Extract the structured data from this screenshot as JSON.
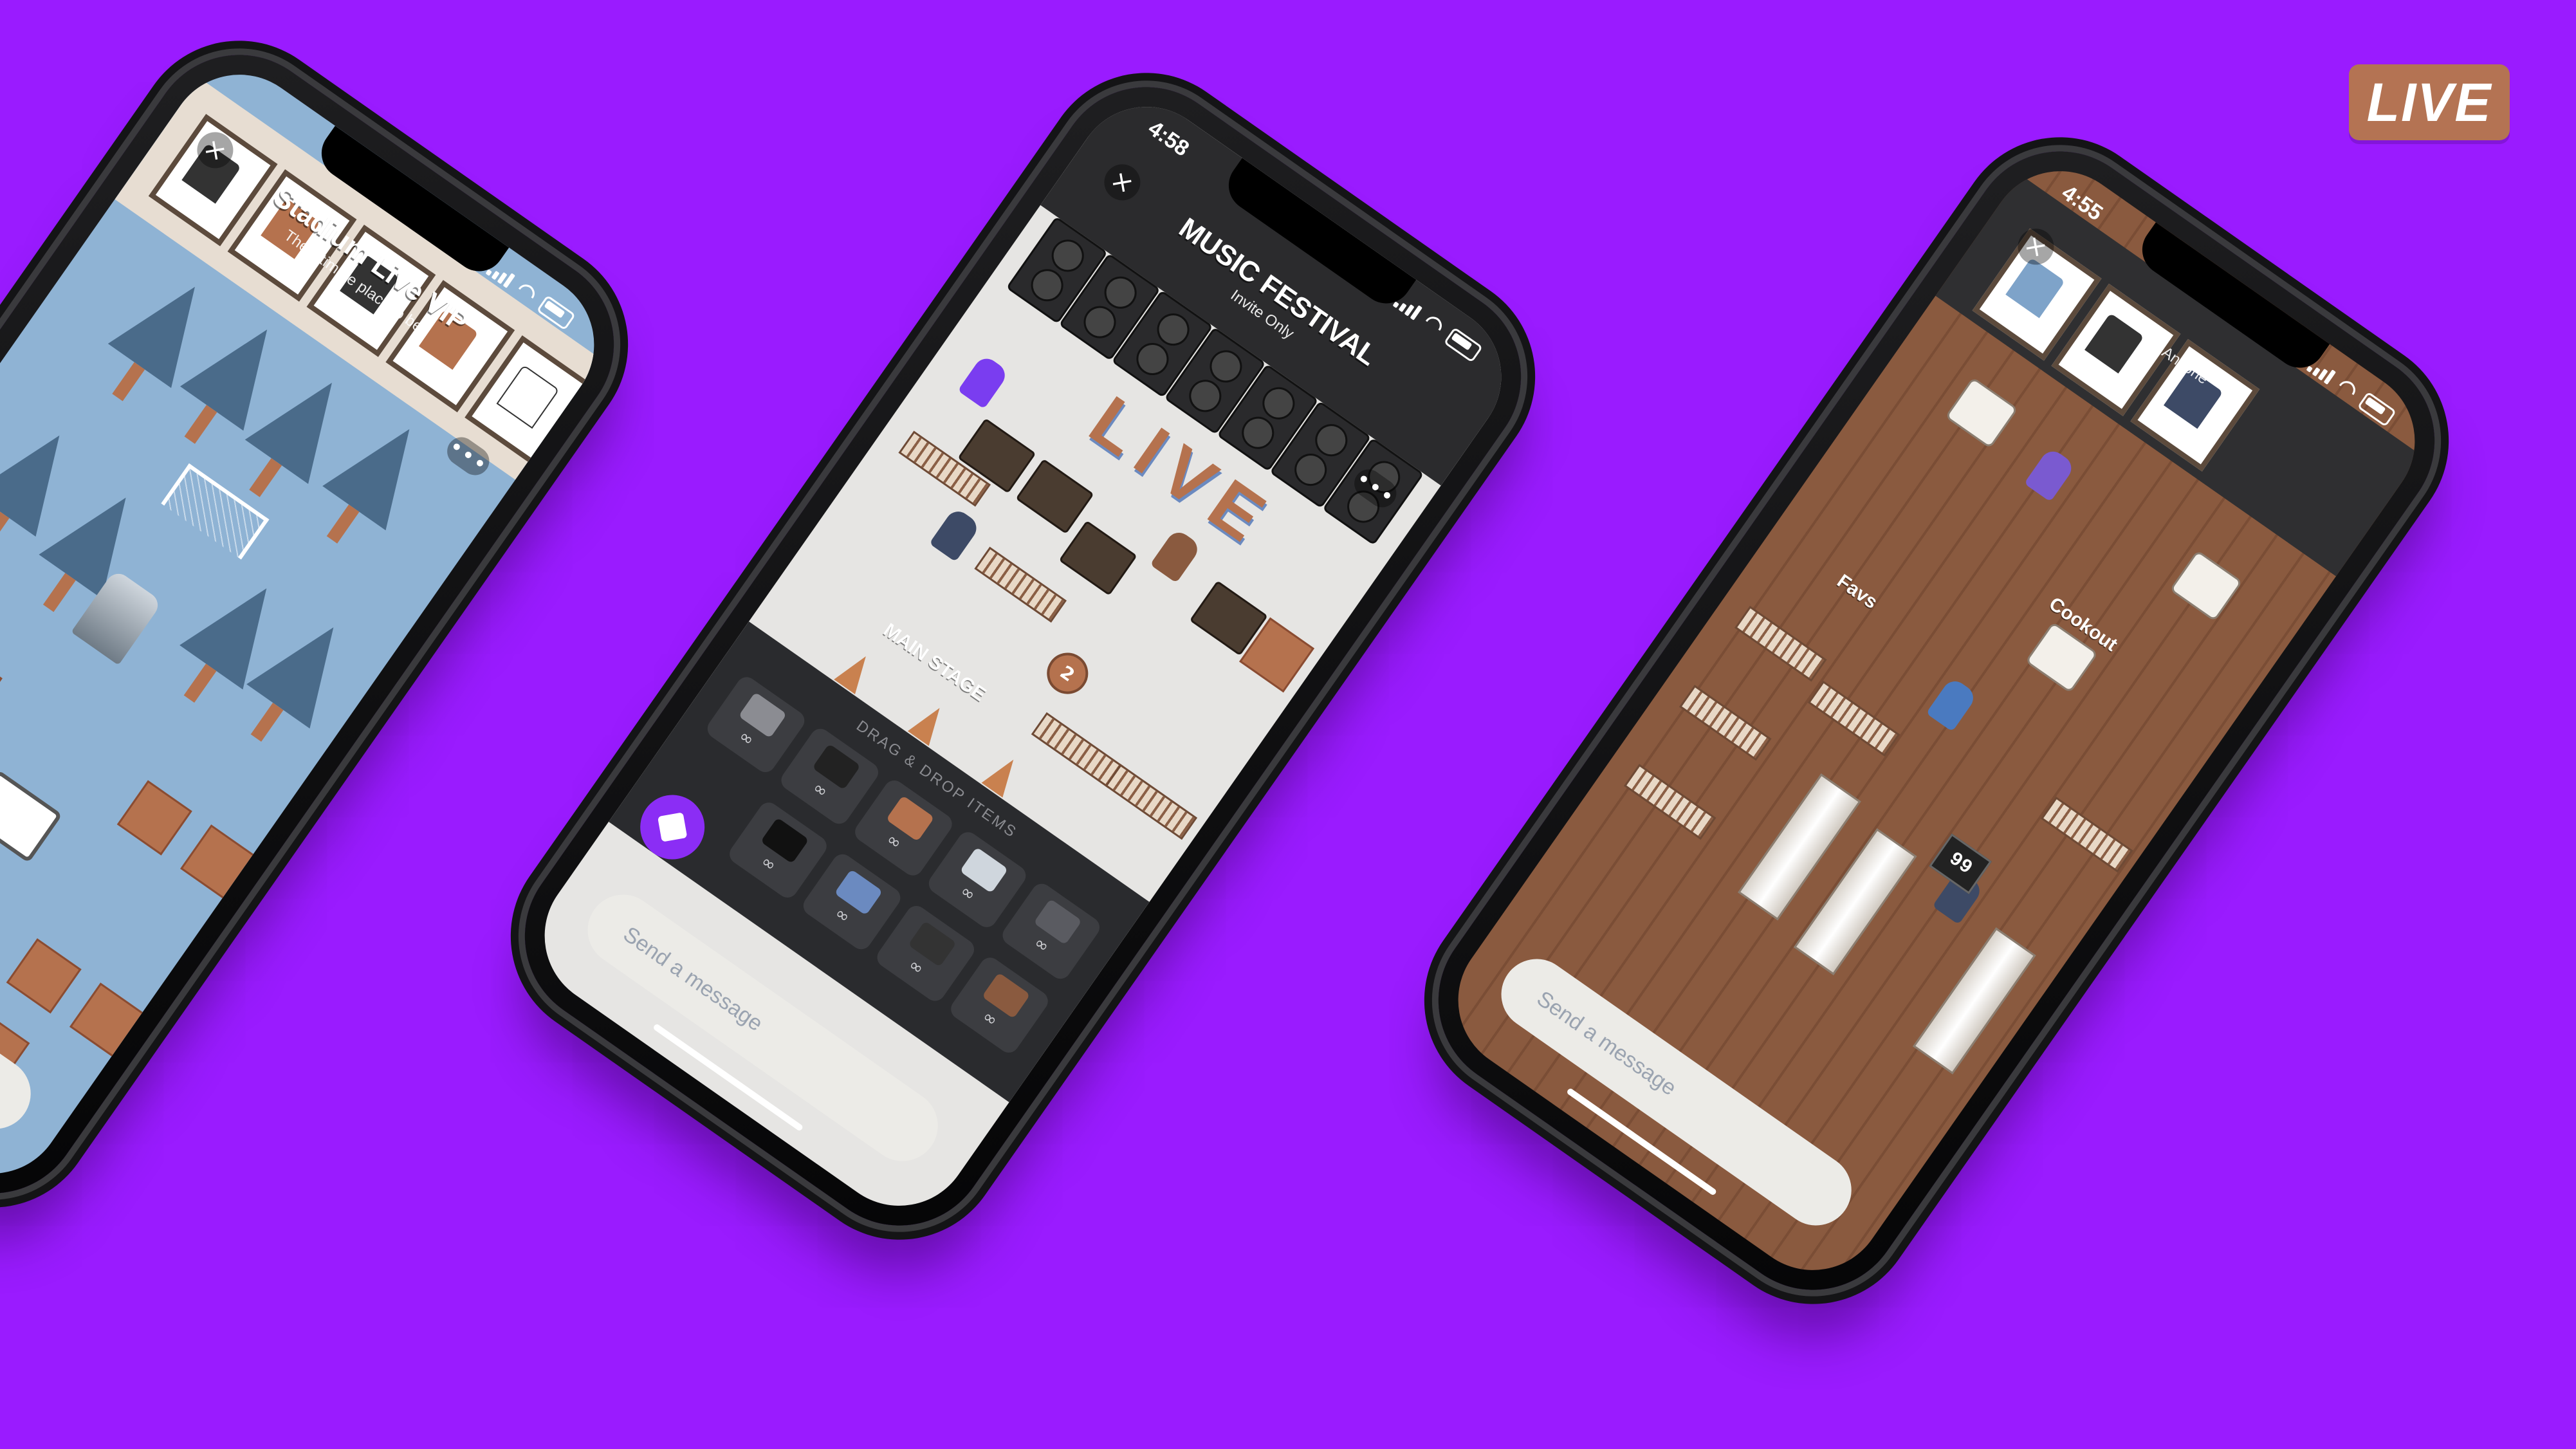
{
  "badge": {
    "label": "LIVE"
  },
  "phones": [
    {
      "time": "",
      "room_title": "Stadium Live VIP",
      "room_subtitle": "The ultimate place to be!",
      "message_placeholder": "",
      "labels": []
    },
    {
      "time": "4:58",
      "room_title": "MUSIC FESTIVAL",
      "room_subtitle": "Invite Only",
      "message_placeholder": "Send a message",
      "sign_text": "LIVE",
      "stage_label": "MAIN STAGE",
      "panel_title": "DRAG & DROP ITEMS",
      "item_qty": "∞",
      "token_count": "2"
    },
    {
      "time": "4:55",
      "room_title": "",
      "room_subtitle": "Anyone",
      "message_placeholder": "Send a message",
      "labels": [
        "Cookout",
        "Favs"
      ],
      "scoreboard": "99"
    }
  ],
  "icons": [
    "close-icon",
    "more-icon",
    "signal-icon",
    "wifi-icon",
    "battery-icon",
    "build-icon"
  ],
  "colors": {
    "background": "#9a1bff",
    "badge": "#b47353",
    "accent": "#8b2df5",
    "tile": "#b5724e",
    "field": "#8fb3d4",
    "floor": "#8a5a3f"
  }
}
